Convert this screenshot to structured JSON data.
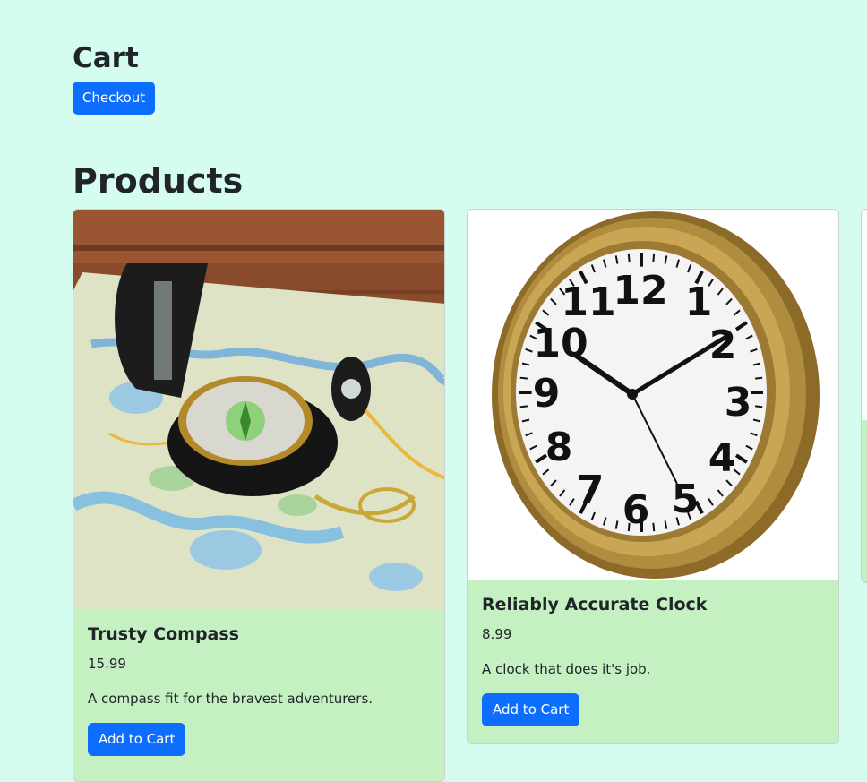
{
  "cart": {
    "title": "Cart",
    "checkout_label": "Checkout"
  },
  "products": {
    "title": "Products",
    "items": [
      {
        "name": "Trusty Compass",
        "price": "15.99",
        "description": "A compass fit for the bravest adventurers.",
        "button_label": "Add to Cart",
        "image": "compass-on-map-image"
      },
      {
        "name": "Reliably Accurate Clock",
        "price": "8.99",
        "description": "A clock that does it's job.",
        "button_label": "Add to Cart",
        "image": "gold-wall-clock-image"
      }
    ]
  },
  "colors": {
    "background": "#d4fdef",
    "card_body": "#c4f0c2",
    "primary": "#0d6efd"
  }
}
